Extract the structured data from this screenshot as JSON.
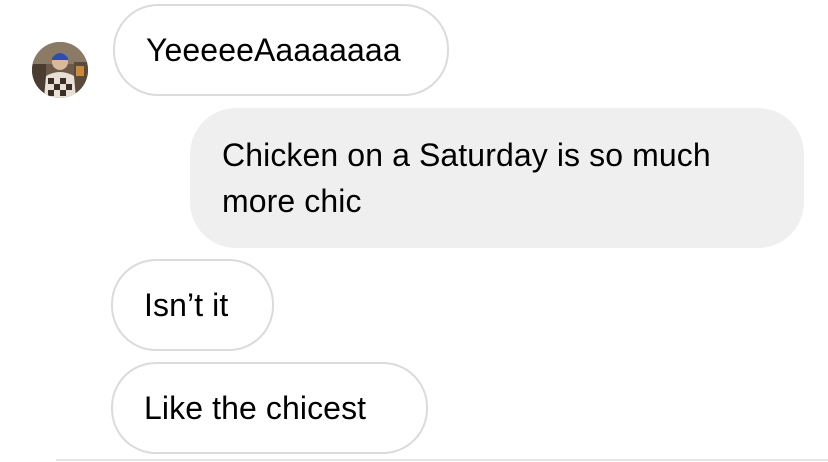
{
  "messages": [
    {
      "sender": "other",
      "text": "YeeeeeAaaaaaaa"
    },
    {
      "sender": "me",
      "text": "Chicken on a Saturday is so much more chic"
    },
    {
      "sender": "other",
      "text": "Isn’t it"
    },
    {
      "sender": "other",
      "text": "Like the chicest"
    }
  ],
  "colors": {
    "incoming_border": "#dbdbdb",
    "outgoing_bg": "#efefef",
    "text": "#000000"
  },
  "icons": {
    "avatar": "user-avatar-photo"
  }
}
